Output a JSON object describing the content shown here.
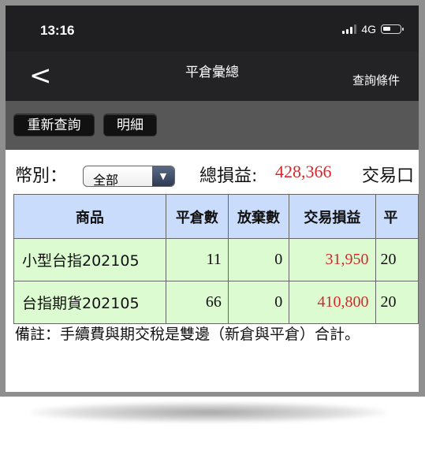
{
  "status_bar": {
    "time": "13:16",
    "network": "4G"
  },
  "nav": {
    "back_glyph": "<",
    "title": "平倉彙總",
    "query_conditions": "查詢條件"
  },
  "toolbar": {
    "requery_label": "重新查詢",
    "detail_label": "明細"
  },
  "filter": {
    "currency_label": "幣別：",
    "currency_selected": "全部",
    "total_pnl_label": "總損益:",
    "total_pnl_value": "428,366",
    "trade_fee_label": "交易口"
  },
  "table": {
    "headers": [
      "商品",
      "平倉數",
      "放棄數",
      "交易損益",
      "平"
    ],
    "rows": [
      {
        "product": "小型台指202105",
        "close_qty": "11",
        "abandon_qty": "0",
        "trade_pnl": "31,950",
        "next": "20"
      },
      {
        "product": "台指期貨202105",
        "close_qty": "66",
        "abandon_qty": "0",
        "trade_pnl": "410,800",
        "next": "20"
      }
    ]
  },
  "note": "備註：手續費與期交稅是雙邊（新倉與平倉）合計。",
  "colors": {
    "negative_red": "#d7262c",
    "header_blue": "#c9dcfb",
    "row_green": "#ddfbd0"
  },
  "icons": [
    "signal-icon",
    "battery-icon",
    "back-chevron-icon",
    "dropdown-arrow-icon"
  ]
}
